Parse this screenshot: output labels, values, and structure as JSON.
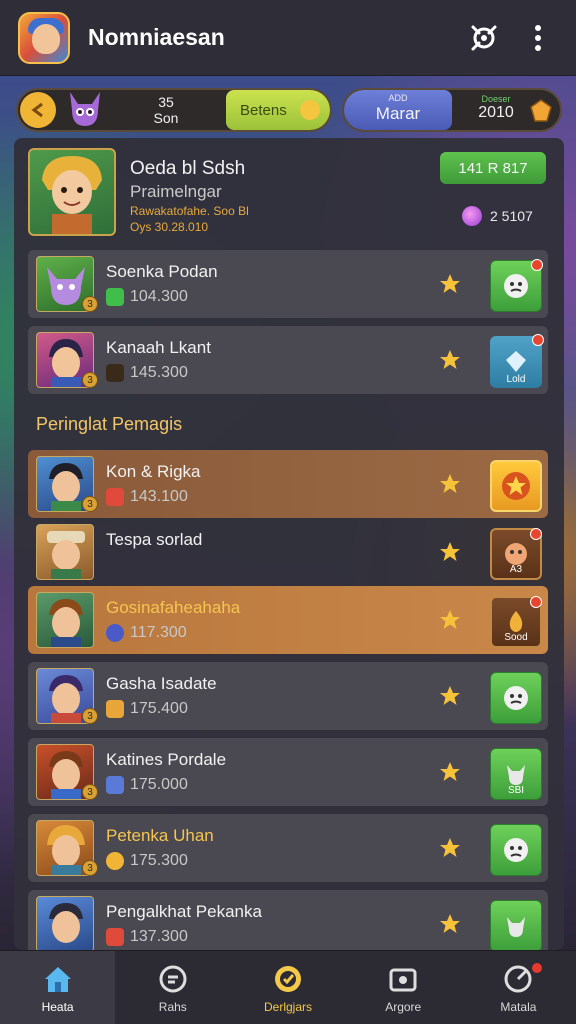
{
  "appbar": {
    "title": "Nomniaesan",
    "icons": [
      "app-logo-icon",
      "share-icon",
      "more-vertical-icon"
    ]
  },
  "currency": {
    "left_stack_top": "35",
    "left_stack_bottom": "Son",
    "green_label": "Betens",
    "blue_small": "ADD",
    "blue_label": "Marar",
    "score_small": "Doeser",
    "score_value": "2010"
  },
  "featured": {
    "name": "Oeda bl Sdsh",
    "role": "Praimelngar",
    "detail1": "Rawakatofahe. Soo Bl",
    "detail2": "Oys 30.28.010",
    "tag": "141 R 817",
    "points": "2 5107"
  },
  "section": {
    "label": "Peringlat Pemagis"
  },
  "rows": [
    {
      "name": "Soenka Podan",
      "score": "104.300",
      "level": "3",
      "action_label": ""
    },
    {
      "name": "Kanaah Lkant",
      "score": "145.300",
      "level": "3",
      "action_label": "Lold"
    },
    {
      "name": "Kon & Rigka",
      "score": "143.100",
      "level": "3",
      "action_label": ""
    },
    {
      "name": "Tespa sorlad",
      "score": "",
      "level": "",
      "action_label": "A3"
    },
    {
      "name": "Gosinafaheahaha",
      "score": "117.300",
      "level": "",
      "action_label": "Sood"
    },
    {
      "name": "Gasha Isadate",
      "score": "175.400",
      "level": "3",
      "action_label": ""
    },
    {
      "name": "Katines Pordale",
      "score": "175.000",
      "level": "3",
      "action_label": "SBI"
    },
    {
      "name": "Petenka Uhan",
      "score": "175.300",
      "level": "3",
      "action_label": ""
    },
    {
      "name": "Pengalkhat Pekanka",
      "score": "137.300",
      "level": "",
      "action_label": ""
    }
  ],
  "nav": [
    {
      "label": "Heata",
      "icon": "home-icon"
    },
    {
      "label": "Rahs",
      "icon": "chat-icon"
    },
    {
      "label": "Derlgjars",
      "icon": "badge-icon"
    },
    {
      "label": "Argore",
      "icon": "shop-icon"
    },
    {
      "label": "Matala",
      "icon": "settings-icon"
    }
  ],
  "colors": {
    "background": "#2b2a33",
    "panel": "#31303a",
    "row": "#4a4952",
    "accent_gold": "#f5c54f",
    "accent_green": "#5fc24e"
  }
}
